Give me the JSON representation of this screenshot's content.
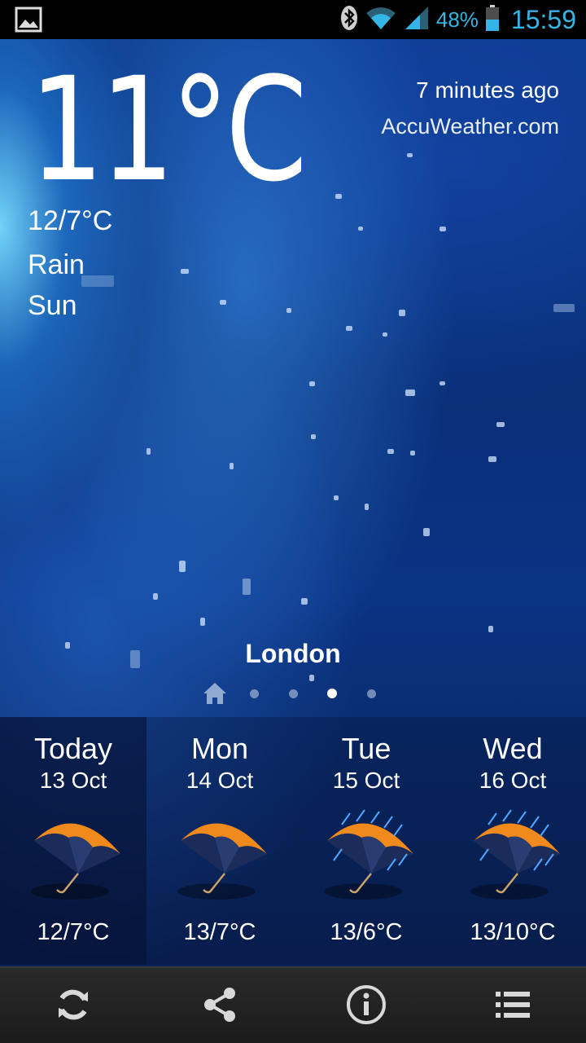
{
  "status_bar": {
    "battery_percent": "48%",
    "time": "15:59",
    "icons": [
      "gallery-icon",
      "bluetooth-icon",
      "wifi-icon",
      "signal-icon",
      "battery-icon"
    ],
    "accent_color": "#33b5e5"
  },
  "current": {
    "temperature": "11°C",
    "hi_lo": "12/7°C",
    "condition_line1": "Rain",
    "condition_line2": "Sun",
    "updated": "7 minutes ago",
    "provider": "AccuWeather.com"
  },
  "location": {
    "city": "London",
    "page_count": 4,
    "active_page": 3
  },
  "forecast": [
    {
      "day": "Today",
      "date": "13 Oct",
      "temp": "12/7°C",
      "icon": "umbrella-icon"
    },
    {
      "day": "Mon",
      "date": "14 Oct",
      "temp": "13/7°C",
      "icon": "umbrella-icon"
    },
    {
      "day": "Tue",
      "date": "15 Oct",
      "temp": "13/6°C",
      "icon": "umbrella-rain-icon"
    },
    {
      "day": "Wed",
      "date": "16 Oct",
      "temp": "13/10°C",
      "icon": "umbrella-rain-icon"
    }
  ],
  "actions": [
    "refresh-icon",
    "share-icon",
    "info-icon",
    "menu-list-icon"
  ]
}
